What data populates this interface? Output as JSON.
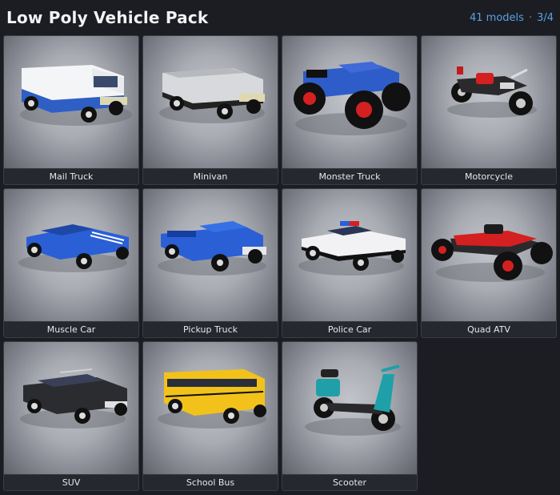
{
  "header": {
    "title": "Low Poly Vehicle Pack",
    "model_count": "41 models",
    "separator": "·",
    "page": "3/4"
  },
  "accent_color": "#5aa0e6",
  "vehicles": [
    {
      "label": "Mail Truck",
      "icon": "mail-truck-render"
    },
    {
      "label": "Minivan",
      "icon": "minivan-render"
    },
    {
      "label": "Monster Truck",
      "icon": "monster-truck-render"
    },
    {
      "label": "Motorcycle",
      "icon": "motorcycle-render"
    },
    {
      "label": "Muscle Car",
      "icon": "muscle-car-render"
    },
    {
      "label": "Pickup Truck",
      "icon": "pickup-truck-render"
    },
    {
      "label": "Police Car",
      "icon": "police-car-render"
    },
    {
      "label": "Quad ATV",
      "icon": "quad-atv-render"
    },
    {
      "label": "SUV",
      "icon": "suv-render"
    },
    {
      "label": "School Bus",
      "icon": "school-bus-render"
    },
    {
      "label": "Scooter",
      "icon": "scooter-render"
    }
  ]
}
